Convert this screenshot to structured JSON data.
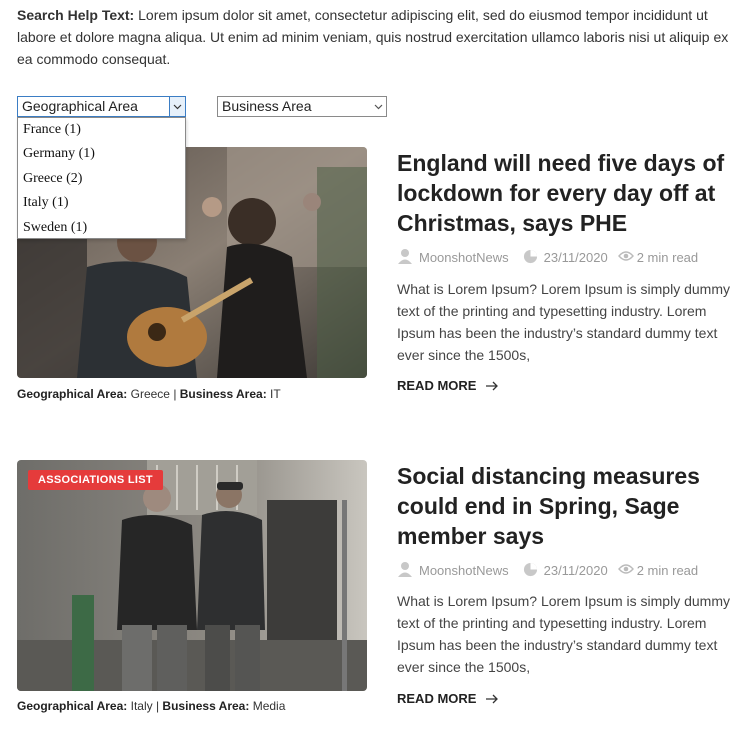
{
  "help": {
    "label": "Search Help Text:",
    "text": " Lorem ipsum dolor sit amet, consectetur adipiscing elit, sed do eiusmod tempor incididunt ut labore et dolore magna aliqua. Ut enim ad minim veniam, quis nostrud exercitation ullamco laboris nisi ut aliquip ex ea commodo consequat."
  },
  "filters": {
    "geo_selected": "Geographical Area",
    "biz_selected": "Business Area",
    "geo_options": [
      "France  (1)",
      "Germany  (1)",
      "Greece  (2)",
      "Italy  (1)",
      "Sweden  (1)"
    ]
  },
  "colors": {
    "badge": "#e53b3b",
    "focus": "#3b7dc4"
  },
  "labels": {
    "geo": "Geographical Area:",
    "biz": "Business Area:",
    "read_more": "READ MORE"
  },
  "posts": [
    {
      "title": "England will need five days of lockdown for every day off at Christmas, says PHE",
      "author": "MoonshotNews",
      "date": "23/11/2020",
      "read_time": "2 min read",
      "excerpt": "What is Lorem Ipsum? Lorem Ipsum is simply dummy text of the printing and typesetting industry. Lorem Ipsum has been the industry’s standard dummy text ever since the 1500s,",
      "geo": "Greece",
      "biz": "IT"
    },
    {
      "badge": "ASSOCIATIONS LIST",
      "title": "Social distancing measures could end in Spring, Sage member says",
      "author": "MoonshotNews",
      "date": "23/11/2020",
      "read_time": "2 min read",
      "excerpt": "What is Lorem Ipsum? Lorem Ipsum is simply dummy text of the printing and typesetting industry. Lorem Ipsum has been the industry’s standard dummy text ever since the 1500s,",
      "geo": "Italy",
      "biz": "Media"
    }
  ]
}
